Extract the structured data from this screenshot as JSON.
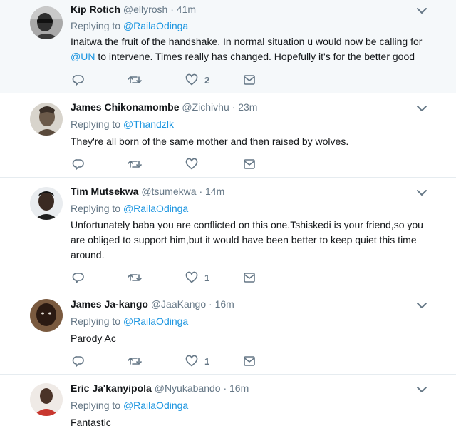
{
  "tweets": [
    {
      "name": "Kip Rotich",
      "handle": "@ellyrosh",
      "sep": "·",
      "time": "41m",
      "replying_label": "Replying to",
      "replying_to": "@RailaOdinga",
      "text_before": "Inaitwa the fruit of the handshake. In normal situation u would now be calling for",
      "text_link": "@UN",
      "text_after": "to intervene. Times really has changed. Hopefully it's for the better good",
      "reply_count": "",
      "retweet_count": "",
      "like_count": "2"
    },
    {
      "name": "James Chikonamombe",
      "handle": "@Zichivhu",
      "sep": "·",
      "time": "23m",
      "replying_label": "Replying to",
      "replying_to": "@Thandzlk",
      "text": "They're all born of the same mother and then raised by wolves.",
      "reply_count": "",
      "retweet_count": "",
      "like_count": ""
    },
    {
      "name": "Tim Mutsekwa",
      "handle": "@tsumekwa",
      "sep": "·",
      "time": "14m",
      "replying_label": "Replying to",
      "replying_to": "@RailaOdinga",
      "text": "Unfortunately baba you are conflicted on this one.Tshiskedi is your friend,so you are obliged to support him,but it would have been better to keep quiet this time around.",
      "reply_count": "",
      "retweet_count": "",
      "like_count": "1"
    },
    {
      "name": "James Ja-kango",
      "handle": "@JaaKango",
      "sep": "·",
      "time": "16m",
      "replying_label": "Replying to",
      "replying_to": "@RailaOdinga",
      "text": "Parody Ac",
      "reply_count": "",
      "retweet_count": "",
      "like_count": "1"
    },
    {
      "name": "Eric Ja'kanyipola",
      "handle": "@Nyukabando",
      "sep": "·",
      "time": "16m",
      "replying_label": "Replying to",
      "replying_to": "@RailaOdinga",
      "text": "Fantastic"
    }
  ],
  "icons": {
    "reply": "reply-icon",
    "retweet": "retweet-icon",
    "like": "heart-icon",
    "dm": "envelope-icon",
    "more": "chevron-down-icon"
  },
  "colors": {
    "link": "#1b95e0",
    "muted": "#657786",
    "text": "#14171a",
    "hover_row": "#f5f8fa",
    "divider": "#e6ecf0"
  }
}
